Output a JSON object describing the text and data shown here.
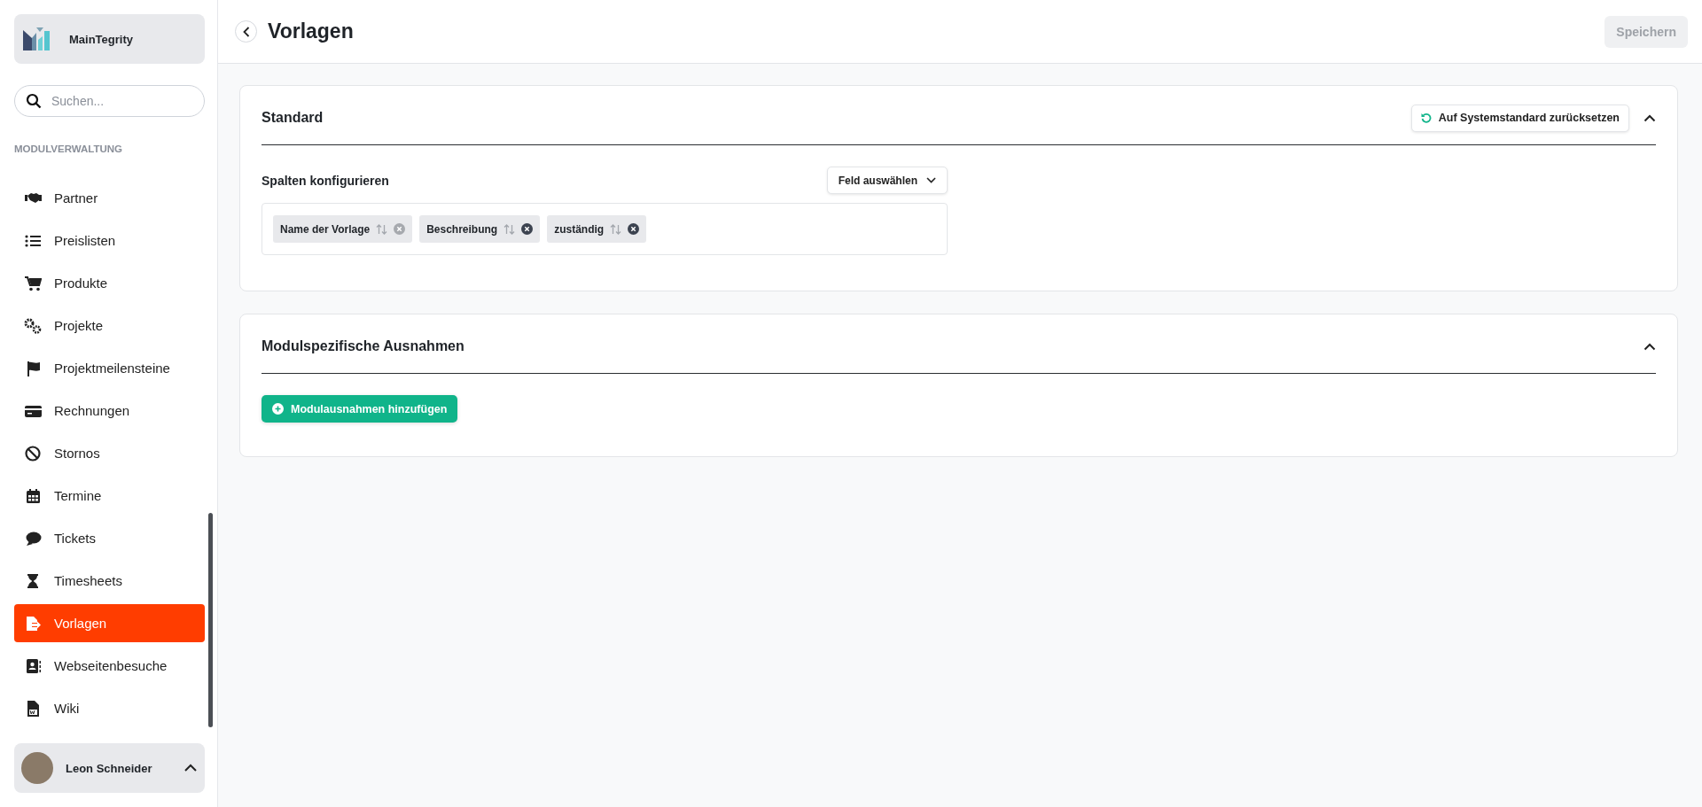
{
  "sidebar": {
    "brand": "MainTegrity",
    "search": {
      "placeholder": "Suchen..."
    },
    "section_label": "MODULVERWALTUNG",
    "items": [
      {
        "label": "Partner",
        "selected": false
      },
      {
        "label": "Preislisten",
        "selected": false
      },
      {
        "label": "Produkte",
        "selected": false
      },
      {
        "label": "Projekte",
        "selected": false
      },
      {
        "label": "Projektmeilensteine",
        "selected": false
      },
      {
        "label": "Rechnungen",
        "selected": false
      },
      {
        "label": "Stornos",
        "selected": false
      },
      {
        "label": "Termine",
        "selected": false
      },
      {
        "label": "Tickets",
        "selected": false
      },
      {
        "label": "Timesheets",
        "selected": false
      },
      {
        "label": "Vorlagen",
        "selected": true
      },
      {
        "label": "Webseitenbesuche",
        "selected": false
      },
      {
        "label": "Wiki",
        "selected": false
      }
    ],
    "user": {
      "name": "Leon Schneider"
    }
  },
  "header": {
    "title": "Vorlagen",
    "save_button": {
      "label": "Speichern",
      "disabled": true
    }
  },
  "standard": {
    "title": "Standard",
    "expanded": true,
    "reset_button": "Auf Systemstandard zurücksetzen",
    "columns_label": "Spalten konfigurieren",
    "field_select": "Feld auswählen",
    "tags": [
      {
        "label": "Name der Vorlage",
        "removable": false
      },
      {
        "label": "Beschreibung",
        "removable": true
      },
      {
        "label": "zuständig",
        "removable": true
      }
    ]
  },
  "exceptions": {
    "title": "Modulspezifische Ausnahmen",
    "expanded": true,
    "add_button": "Modulausnahmen hinzufügen"
  }
}
